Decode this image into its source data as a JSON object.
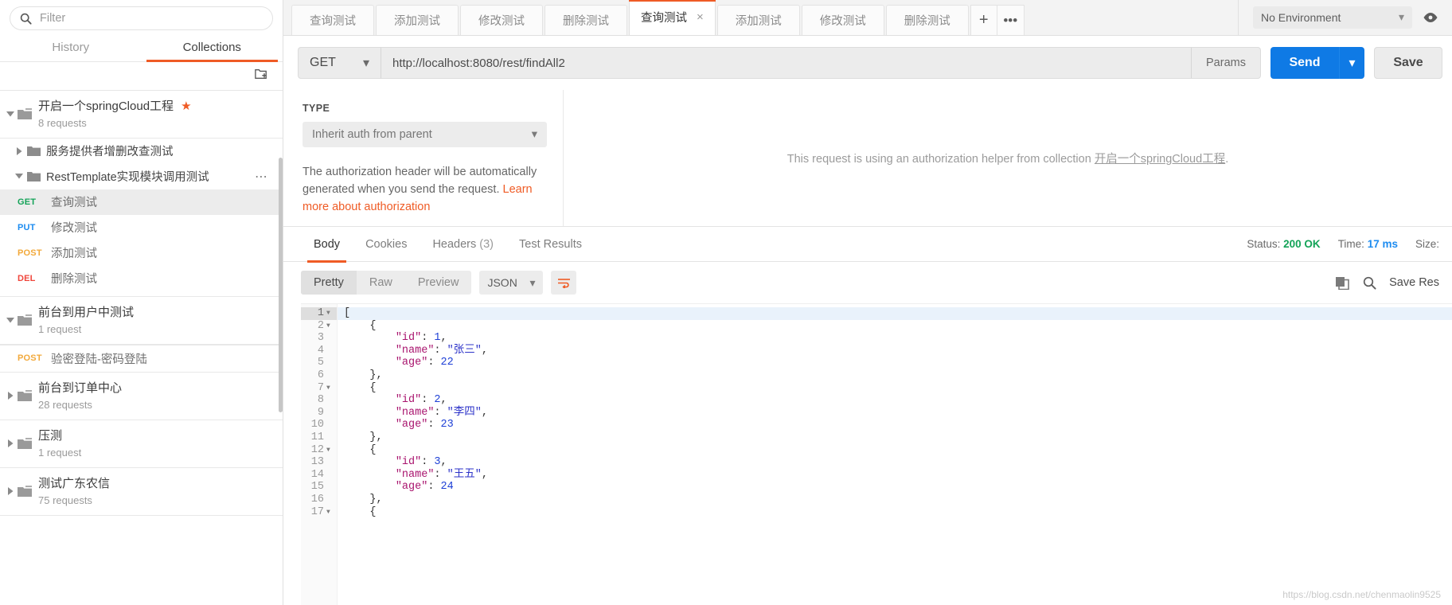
{
  "sidebar": {
    "search": {
      "placeholder": "Filter",
      "value": "",
      "icon": "search-icon"
    },
    "tabs": [
      {
        "label": "History",
        "active": false
      },
      {
        "label": "Collections",
        "active": true
      }
    ],
    "new_folder_icon": "new-collection-icon",
    "collections": [
      {
        "name": "开启一个springCloud工程",
        "requests_label": "8 requests",
        "starred": true,
        "star_color": "#ef5b25",
        "expanded": true
      },
      {
        "name": "前台到用户中测试",
        "requests_label": "1 request",
        "starred": false,
        "expanded": true
      },
      {
        "name": "前台到订单中心",
        "requests_label": "28 requests",
        "starred": false,
        "expanded": false
      },
      {
        "name": "压测",
        "requests_label": "1 request",
        "starred": false,
        "expanded": false
      },
      {
        "name": "测试广东农信",
        "requests_label": "75 requests",
        "starred": false,
        "expanded": false
      }
    ],
    "folders": [
      {
        "name": "服务提供者增删改查测试",
        "expanded": false
      },
      {
        "name": "RestTemplate实现模块调用测试",
        "expanded": true,
        "has_dots": true
      }
    ],
    "requests": [
      {
        "method": "GET",
        "name": "查询测试",
        "selected": true
      },
      {
        "method": "PUT",
        "name": "修改测试",
        "selected": false
      },
      {
        "method": "POST",
        "name": "添加测试",
        "selected": false
      },
      {
        "method": "DEL",
        "name": "删除测试",
        "selected": false
      }
    ],
    "user_requests": [
      {
        "method": "POST",
        "name": "验密登陆-密码登陆",
        "selected": false
      }
    ],
    "method_colors": {
      "GET": "#14a358",
      "PUT": "#1d8cf0",
      "POST": "#f2a93b",
      "DEL": "#f0463c"
    }
  },
  "tabstrip": {
    "tabs": [
      {
        "label": "查询测试",
        "active": false
      },
      {
        "label": "添加测试",
        "active": false
      },
      {
        "label": "修改测试",
        "active": false
      },
      {
        "label": "删除测试",
        "active": false
      },
      {
        "label": "查询测试",
        "active": true,
        "close": "×"
      },
      {
        "label": "添加测试",
        "active": false
      },
      {
        "label": "修改测试",
        "active": false
      },
      {
        "label": "删除测试",
        "active": false
      }
    ],
    "add_tab": "+",
    "more_tabs": "•••",
    "environment": "No Environment",
    "environment_caret": "▾",
    "eye_icon": "eye-icon"
  },
  "request": {
    "method": "GET",
    "method_caret": "▾",
    "url": "http://localhost:8080/rest/findAll2",
    "params_label": "Params",
    "send_label": "Send",
    "send_caret": "▾",
    "save_label": "Save"
  },
  "auth": {
    "type_label": "TYPE",
    "type_value": "Inherit auth from parent",
    "type_caret": "▾",
    "note_prefix": "The authorization header will be automatically generated when you send the request. ",
    "note_link": "Learn more about authorization",
    "helper_prefix": "This request is using an authorization helper from collection ",
    "helper_collection": "开启一个springCloud工程",
    "helper_suffix": "."
  },
  "response": {
    "tabs": [
      {
        "label": "Body",
        "active": true,
        "count": ""
      },
      {
        "label": "Cookies",
        "active": false,
        "count": ""
      },
      {
        "label": "Headers",
        "active": false,
        "count": "(3)"
      },
      {
        "label": "Test Results",
        "active": false,
        "count": ""
      }
    ],
    "status_key": "Status:",
    "status_value": "200 OK",
    "status_color": "#14a358",
    "time_key": "Time:",
    "time_value": "17 ms",
    "size_key": "Size:",
    "size_value": "",
    "view_modes": [
      {
        "label": "Pretty",
        "active": true
      },
      {
        "label": "Raw",
        "active": false
      },
      {
        "label": "Preview",
        "active": false
      }
    ],
    "format": "JSON",
    "format_caret": "▾",
    "wrap_icon": "word-wrap-icon",
    "copy_icon": "copy-icon",
    "search_icon": "search-icon",
    "save_response_label": "Save Res"
  },
  "body": {
    "lines": [
      {
        "n": 1,
        "fold": true,
        "text": "[",
        "hl": true
      },
      {
        "n": 2,
        "fold": true,
        "text": "    {"
      },
      {
        "n": 3,
        "fold": false,
        "key": "\"id\"",
        "val": "1",
        "suffix": ","
      },
      {
        "n": 4,
        "fold": false,
        "key": "\"name\"",
        "val": "\"张三\"",
        "suffix": ",",
        "str": true
      },
      {
        "n": 5,
        "fold": false,
        "key": "\"age\"",
        "val": "22",
        "suffix": ""
      },
      {
        "n": 6,
        "fold": false,
        "text": "    },"
      },
      {
        "n": 7,
        "fold": true,
        "text": "    {"
      },
      {
        "n": 8,
        "fold": false,
        "key": "\"id\"",
        "val": "2",
        "suffix": ","
      },
      {
        "n": 9,
        "fold": false,
        "key": "\"name\"",
        "val": "\"李四\"",
        "suffix": ",",
        "str": true
      },
      {
        "n": 10,
        "fold": false,
        "key": "\"age\"",
        "val": "23",
        "suffix": ""
      },
      {
        "n": 11,
        "fold": false,
        "text": "    },"
      },
      {
        "n": 12,
        "fold": true,
        "text": "    {"
      },
      {
        "n": 13,
        "fold": false,
        "key": "\"id\"",
        "val": "3",
        "suffix": ","
      },
      {
        "n": 14,
        "fold": false,
        "key": "\"name\"",
        "val": "\"王五\"",
        "suffix": ",",
        "str": true
      },
      {
        "n": 15,
        "fold": false,
        "key": "\"age\"",
        "val": "24",
        "suffix": ""
      },
      {
        "n": 16,
        "fold": false,
        "text": "    },"
      },
      {
        "n": 17,
        "fold": true,
        "text": "    {"
      }
    ],
    "records": [
      {
        "id": 1,
        "name": "张三",
        "age": 22
      },
      {
        "id": 2,
        "name": "李四",
        "age": 23
      },
      {
        "id": 3,
        "name": "王五",
        "age": 24
      }
    ]
  },
  "watermark": "https://blog.csdn.net/chenmaolin9525"
}
